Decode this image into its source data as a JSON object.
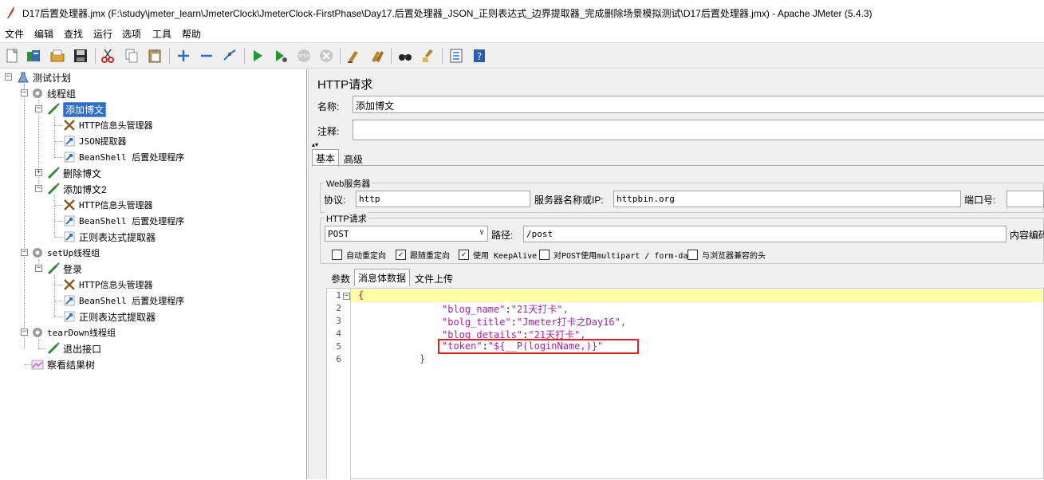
{
  "window": {
    "title": "D17后置处理器.jmx (F:\\study\\jmeter_learn\\JmeterClock\\JmeterClock-FirstPhase\\Day17.后置处理器_JSON_正则表达式_边界提取器_完成删除场景模拟测试\\D17后置处理器.jmx) - Apache JMeter (5.4.3)"
  },
  "menu": [
    "文件",
    "编辑",
    "查找",
    "运行",
    "选项",
    "工具",
    "帮助"
  ],
  "toolbar": [
    "new-icon",
    "templates-icon",
    "open-icon",
    "save-icon",
    "cut-icon",
    "copy-icon",
    "paste-icon",
    "expand-icon",
    "collapse-icon",
    "toggle-icon",
    "start-icon",
    "start-no-pause-icon",
    "stop-icon",
    "shutdown-icon",
    "clear-icon",
    "clear-all-icon",
    "search-icon",
    "reset-search-icon",
    "function-helper-icon",
    "help-icon"
  ],
  "tree": {
    "items": [
      {
        "label": "测试计划",
        "icon": "test-plan-icon"
      },
      {
        "label": "线程组",
        "icon": "gear-icon"
      },
      {
        "label": "添加博文",
        "icon": "sampler-icon"
      },
      {
        "label": "HTTP信息头管理器",
        "icon": "tools-icon"
      },
      {
        "label": "JSON提取器",
        "icon": "post-processor-icon"
      },
      {
        "label": "BeanShell 后置处理程序",
        "icon": "post-processor-icon"
      },
      {
        "label": "删除博文",
        "icon": "sampler-icon"
      },
      {
        "label": "添加博文2",
        "icon": "sampler-icon"
      },
      {
        "label": "HTTP信息头管理器",
        "icon": "tools-icon"
      },
      {
        "label": "BeanShell 后置处理程序",
        "icon": "post-processor-icon"
      },
      {
        "label": "正则表达式提取器",
        "icon": "post-processor-icon"
      },
      {
        "label": "setUp线程组",
        "icon": "gear-icon"
      },
      {
        "label": "登录",
        "icon": "sampler-icon"
      },
      {
        "label": "HTTP信息头管理器",
        "icon": "tools-icon"
      },
      {
        "label": "BeanShell 后置处理程序",
        "icon": "post-processor-icon"
      },
      {
        "label": "正则表达式提取器",
        "icon": "post-processor-icon"
      },
      {
        "label": "tearDown线程组",
        "icon": "gear-icon"
      },
      {
        "label": "退出接口",
        "icon": "sampler-icon"
      },
      {
        "label": "察看结果树",
        "icon": "listener-icon"
      }
    ]
  },
  "panel": {
    "title": "HTTP请求",
    "name_label": "名称:",
    "name_value": "添加博文",
    "comment_label": "注释:",
    "comment_value": "",
    "tabs": [
      "基本",
      "高级"
    ],
    "web_server": {
      "title": "Web服务器",
      "protocol_label": "协议:",
      "protocol_value": "http",
      "server_label": "服务器名称或IP:",
      "server_value": "httpbin.org",
      "port_label": "端口号:",
      "port_value": ""
    },
    "http_request": {
      "title": "HTTP请求",
      "method": "POST",
      "path_label": "路径:",
      "path_value": "/post",
      "encoding_label": "内容编码"
    },
    "checkboxes": [
      {
        "label": "自动重定向",
        "checked": false
      },
      {
        "label": "跟随重定向",
        "checked": true
      },
      {
        "label": "使用 KeepAlive",
        "checked": true
      },
      {
        "label": "对POST使用multipart / form-data",
        "checked": false
      },
      {
        "label": "与浏览器兼容的头",
        "checked": false
      }
    ],
    "body_tabs": [
      "参数",
      "消息体数据",
      "文件上传"
    ],
    "body_lines": [
      {
        "num": "1",
        "key": "{",
        "sep": "",
        "val": ""
      },
      {
        "num": "2",
        "key": "\"blog_name\"",
        "sep": ":",
        "val": "\"21天打卡\","
      },
      {
        "num": "3",
        "key": "\"bolg_title\"",
        "sep": ":",
        "val": "\"Jmeter打卡之Day16\","
      },
      {
        "num": "4",
        "key": "\"blog_details\"",
        "sep": ":",
        "val": "\"21天打卡\","
      },
      {
        "num": "5",
        "key": "\"token\"",
        "sep": ":",
        "val": "\"${__P(loginName,)}\""
      },
      {
        "num": "6",
        "key": "}",
        "sep": "",
        "val": ""
      }
    ]
  }
}
